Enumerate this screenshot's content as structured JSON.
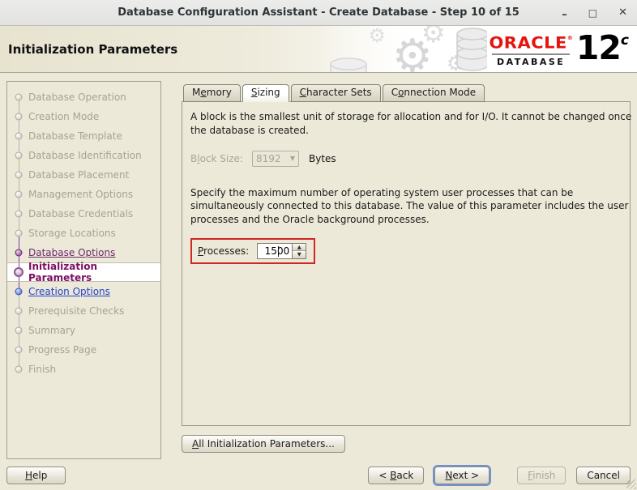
{
  "window": {
    "title": "Database Configuration Assistant - Create Database - Step 10 of 15",
    "controls": {
      "minimize_icon": "–",
      "maximize_icon": "□",
      "close_icon": "✕"
    }
  },
  "header": {
    "title": "Initialization Parameters",
    "gear_icon": "⚙",
    "logo": {
      "brand": "ORACLE",
      "registered": "®",
      "product": "DATABASE",
      "version": "12",
      "version_suffix": "c"
    }
  },
  "sidebar": {
    "steps": [
      {
        "label": "Database Operation",
        "state": "pending"
      },
      {
        "label": "Creation Mode",
        "state": "pending"
      },
      {
        "label": "Database Template",
        "state": "pending"
      },
      {
        "label": "Database Identification",
        "state": "pending"
      },
      {
        "label": "Database Placement",
        "state": "pending"
      },
      {
        "label": "Management Options",
        "state": "pending"
      },
      {
        "label": "Database Credentials",
        "state": "pending"
      },
      {
        "label": "Storage Locations",
        "state": "pending"
      },
      {
        "label": "Database Options",
        "state": "visited"
      },
      {
        "label": "Initialization Parameters",
        "state": "current"
      },
      {
        "label": "Creation Options",
        "state": "next"
      },
      {
        "label": "Prerequisite Checks",
        "state": "pending"
      },
      {
        "label": "Summary",
        "state": "pending"
      },
      {
        "label": "Progress Page",
        "state": "pending"
      },
      {
        "label": "Finish",
        "state": "pending"
      }
    ]
  },
  "tabs": [
    {
      "name": "memory",
      "pre": "M",
      "key": "e",
      "post": "mory",
      "active": false
    },
    {
      "name": "sizing",
      "pre": "",
      "key": "S",
      "post": "izing",
      "active": true
    },
    {
      "name": "character-sets",
      "pre": "",
      "key": "C",
      "post": "haracter Sets",
      "active": false
    },
    {
      "name": "connection-mode",
      "pre": "C",
      "key": "o",
      "post": "nnection Mode",
      "active": false
    }
  ],
  "content": {
    "block_info": "A block is the smallest unit of storage for allocation and for I/O. It cannot be changed once the database is created.",
    "block_size": {
      "label_pre": "B",
      "label_key": "l",
      "label_post": "ock Size:",
      "value": "8192",
      "unit": "Bytes"
    },
    "processes_info": "Specify the maximum number of operating system user processes that can be simultaneously connected to this database. The value of this parameter includes the user processes and the Oracle background processes.",
    "processes": {
      "label_pre": "",
      "label_key": "P",
      "label_post": "rocesses:",
      "value": "1500"
    },
    "all_params_button": {
      "pre": "",
      "key": "A",
      "post": "ll Initialization Parameters..."
    }
  },
  "footer": {
    "help": {
      "pre": "",
      "key": "H",
      "post": "elp"
    },
    "back": {
      "pre": "< ",
      "key": "B",
      "post": "ack"
    },
    "next": {
      "pre": "",
      "key": "N",
      "post": "ext >"
    },
    "finish": {
      "pre": "",
      "key": "F",
      "post": "inish"
    },
    "cancel": {
      "label": "Cancel"
    }
  },
  "colors": {
    "annotation_red": "#cf2722",
    "oracle_red": "#e5140e",
    "link_purple": "#6d2a6d",
    "current_step_text": "#7d0e63",
    "link_blue": "#2442c8",
    "line_visited": "#7b3fa0",
    "line_pending": "#b7b4a7"
  }
}
